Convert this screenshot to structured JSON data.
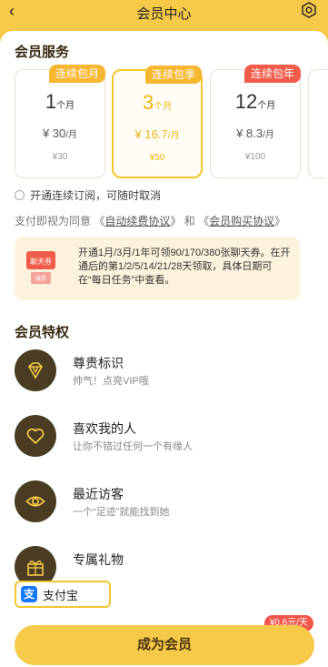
{
  "header": {
    "title": "会员中心"
  },
  "services": {
    "title": "会员服务",
    "plans": [
      {
        "tag": "连续包月",
        "tag_color": "#f7b731",
        "num": "1",
        "num_unit": "个月",
        "price": "¥ 30",
        "price_unit": "/月",
        "orig": "¥30",
        "selected": false
      },
      {
        "tag": "连续包季",
        "tag_color": "#f7b731",
        "num": "3",
        "num_unit": "个月",
        "price": "¥ 16.7",
        "price_unit": "/月",
        "orig": "¥50",
        "selected": true
      },
      {
        "tag": "连续包年",
        "tag_color": "#f25c4a",
        "num": "12",
        "num_unit": "个月",
        "price": "¥ 8.3",
        "price_unit": "/月",
        "orig": "¥100",
        "selected": false
      }
    ]
  },
  "autorenew": {
    "label": "开通连续订阅，可随时取消"
  },
  "agreement": {
    "prefix": "支付即视为同意",
    "link1": "自动续费协议",
    "mid": "和",
    "link2": "会员购买协议"
  },
  "coupon": {
    "icon_top": "聊天券",
    "icon_bottom": "赠券",
    "text": "开通1月/3月/1年可领90/170/380张聊天券。在开通后的第1/2/5/14/21/28天领取，具体日期可在“每日任务”中查看。"
  },
  "privileges": {
    "title": "会员特权",
    "items": [
      {
        "name": "尊贵标识",
        "desc": "帅气！点亮VIP哦",
        "icon": "vip-diamond-icon"
      },
      {
        "name": "喜欢我的人",
        "desc": "让你不错过任何一个有缘人",
        "icon": "heart-icon"
      },
      {
        "name": "最近访客",
        "desc": "一个“足迹”就能找到她",
        "icon": "eye-icon"
      },
      {
        "name": "专属礼物",
        "desc": "",
        "icon": "gift-icon"
      }
    ]
  },
  "payment": {
    "label": "支付宝",
    "icon_text": "支"
  },
  "cta": {
    "label": "成为会员",
    "badge": "¥0.6元/天"
  },
  "colors": {
    "accent": "#f7c948",
    "selected_text": "#f0b412",
    "red_tag": "#f25c4a",
    "icon_bg": "#4a3c22"
  }
}
